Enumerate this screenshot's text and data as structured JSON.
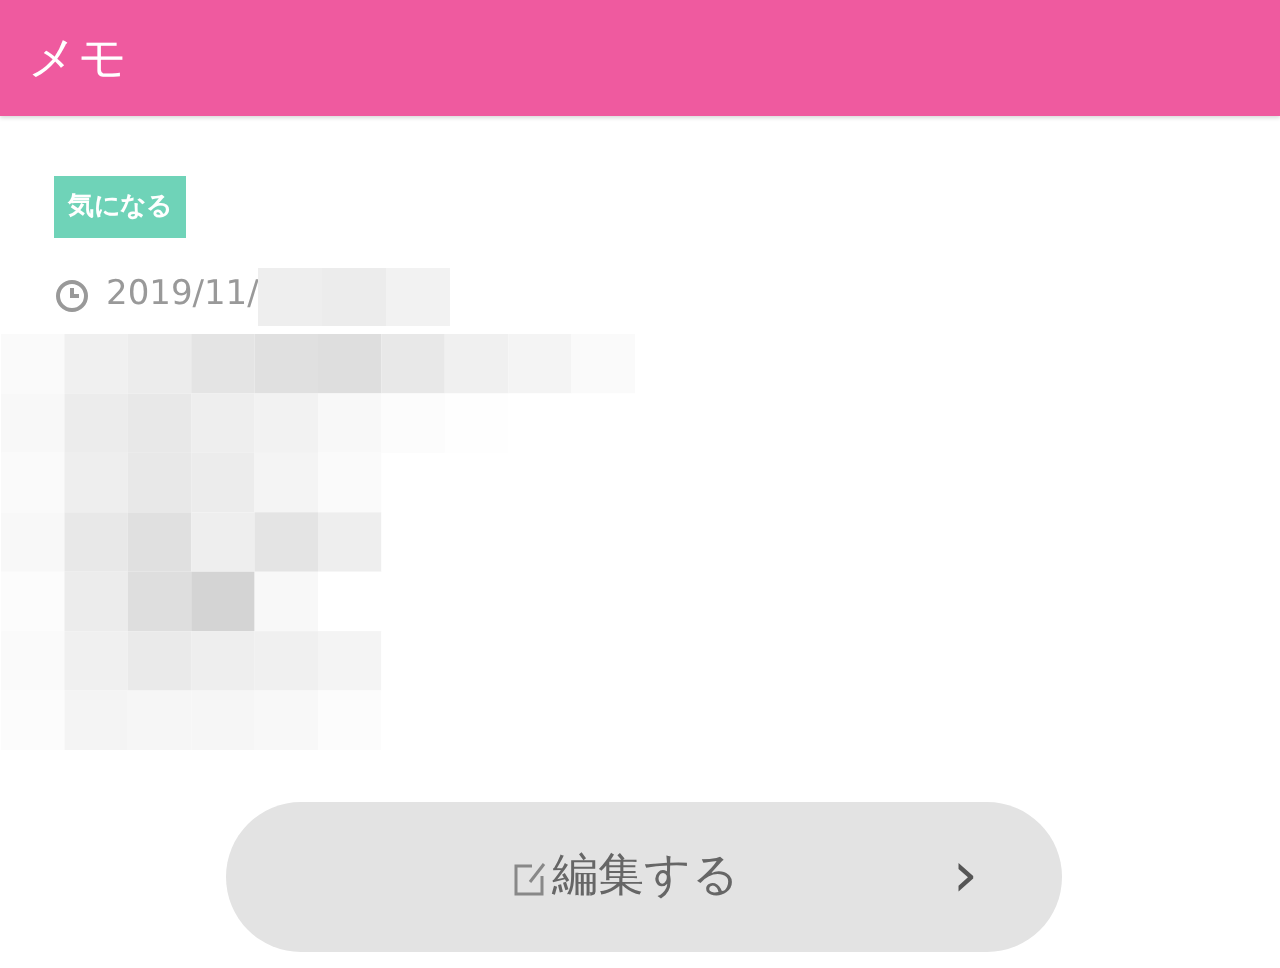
{
  "header": {
    "title": "メモ"
  },
  "tag": {
    "label": "気になる"
  },
  "date": {
    "text": "2019/11/"
  },
  "edit_button": {
    "label": "編集する",
    "chevron": "›"
  }
}
